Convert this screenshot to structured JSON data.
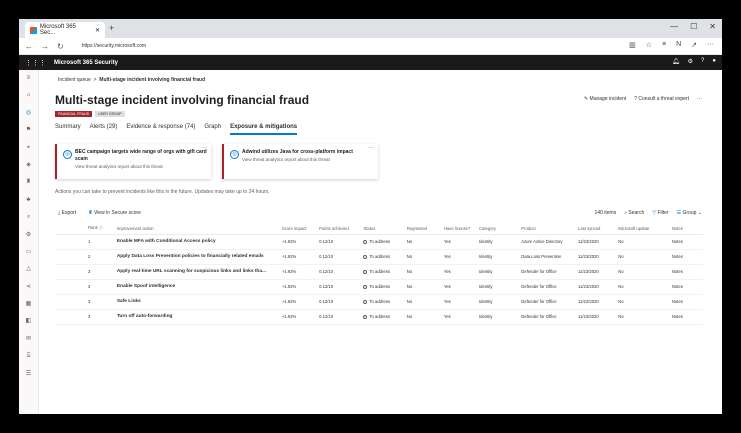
{
  "browser": {
    "tab_title": "Microsoft 365 Sec...",
    "tab_close": "✕",
    "new_tab": "+",
    "url": "https://security.microsoft.com"
  },
  "suite": {
    "title": "Microsoft 365 Security"
  },
  "breadcrumb": {
    "root": "Incident queue",
    "separator": ">",
    "current": "Multi-stage incident involving financial fraud"
  },
  "page": {
    "title": "Multi-stage incident involving financial fraud",
    "tags": [
      "FINANCIAL FRAUD",
      "USER GROUP"
    ],
    "manage_label": "Manage incident",
    "consult_label": "Consult a threat expert",
    "more": "···"
  },
  "tabs": [
    "Summary",
    "Alerts (29)",
    "Evidence & response (74)",
    "Graph",
    "Exposure & mitigations"
  ],
  "cards": [
    {
      "title": "BEC campaign targets wide range of orgs with gift card scam",
      "subtitle": "View threat analytics report about this threat",
      "more": "···"
    },
    {
      "title": "Adwind utilizes Java for cross-platform impact",
      "subtitle": "View threat analytics report about this threat",
      "more": "···"
    }
  ],
  "note": "Actions you can take to prevent incidents like this in the future. Updates may take up to 24 hours.",
  "toolbar": {
    "export": "Export",
    "secure_score": "View in Secure score",
    "count": "140 items",
    "search": "Search",
    "filter": "Filter",
    "group": "Group"
  },
  "table": {
    "headers": [
      "",
      "Rank ⓘ",
      "Improvement action",
      "Score impact",
      "Points achieved",
      "Status",
      "Regressed",
      "Have license?",
      "Category",
      "Product",
      "Last synced",
      "Microsoft update",
      "Notes"
    ],
    "rows": [
      {
        "rank": "1",
        "action": "Enable MFA with Conditional Access policy",
        "score": "+1.92%",
        "points": "0.12/10",
        "status": "To address",
        "regressed": "No",
        "license": "Yes",
        "category": "Identity",
        "product": "Azure Active Directory",
        "synced": "11/23/2020",
        "update": "No",
        "notes": "Notes"
      },
      {
        "rank": "2",
        "action": "Apply Data Loss Prevention policies to financially related emails",
        "score": "+1.92%",
        "points": "0.12/10",
        "status": "To address",
        "regressed": "No",
        "license": "Yes",
        "category": "Identity",
        "product": "Data Loss Prevention",
        "synced": "11/23/2020",
        "update": "No",
        "notes": "Notes"
      },
      {
        "rank": "3",
        "action": "Apply real-time URL scanning for suspicious links and links tha...",
        "score": "+1.92%",
        "points": "0.12/10",
        "status": "To address",
        "regressed": "No",
        "license": "Yes",
        "category": "Identity",
        "product": "Defender for Office",
        "synced": "11/23/2020",
        "update": "No",
        "notes": "Notes"
      },
      {
        "rank": "3",
        "action": "Enable Spoof intelligence",
        "score": "+1.92%",
        "points": "0.12/10",
        "status": "To address",
        "regressed": "No",
        "license": "Yes",
        "category": "Identity",
        "product": "Defender for Office",
        "synced": "11/23/2020",
        "update": "No",
        "notes": "Notes"
      },
      {
        "rank": "3",
        "action": "Safe Links",
        "score": "+1.92%",
        "points": "0.12/10",
        "status": "To address",
        "regressed": "No",
        "license": "Yes",
        "category": "Identity",
        "product": "Defender for Office",
        "synced": "11/23/2020",
        "update": "No",
        "notes": "Notes"
      },
      {
        "rank": "3",
        "action": "Turn off auto-forwarding",
        "score": "+1.92%",
        "points": "0.12/10",
        "status": "To address",
        "regressed": "No",
        "license": "Yes",
        "category": "Identity",
        "product": "Defender for Office",
        "synced": "11/23/2020",
        "update": "No",
        "notes": "Notes"
      }
    ]
  },
  "colors": {
    "accent": "#0078d4",
    "danger": "#a4262c",
    "suite_bar": "#1b1a19"
  },
  "icons": [
    "home-icon",
    "shield-icon",
    "incident-icon",
    "hunting-icon",
    "action-center-icon",
    "trophy-icon",
    "partners-icon",
    "search-icon",
    "settings-icon",
    "devices-icon",
    "gear-icon",
    "bell-icon",
    "help-icon"
  ]
}
